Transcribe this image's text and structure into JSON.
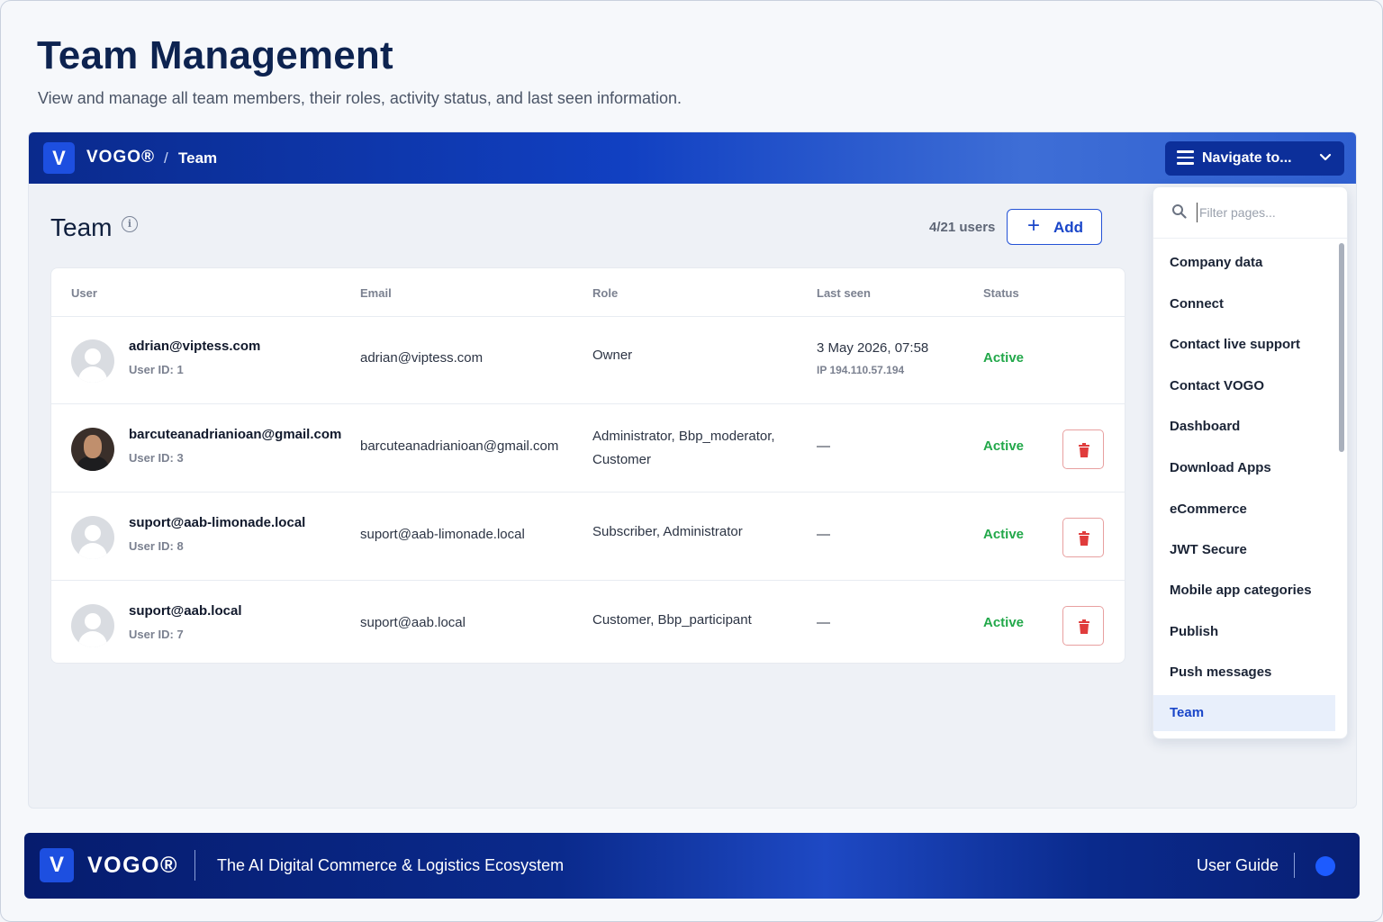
{
  "header": {
    "title": "Team Management",
    "subtitle": "View and manage all team members, their roles, activity status, and last seen information."
  },
  "topbar": {
    "logo_letter": "V",
    "brand": "VOGO®",
    "separator": "/",
    "crumb": "Team",
    "navigate_label": "Navigate to..."
  },
  "team": {
    "title": "Team",
    "users_count": "4/21 users",
    "add_label": "Add",
    "columns": {
      "user": "User",
      "email": "Email",
      "role": "Role",
      "last_seen": "Last seen",
      "status": "Status"
    },
    "rows": [
      {
        "name": "adrian@viptess.com",
        "user_id": "User ID: 1",
        "email": "adrian@viptess.com",
        "role": "Owner",
        "last_seen": "3 May 2026, 07:58",
        "ip": "IP 194.110.57.194",
        "status": "Active",
        "avatar": "placeholder",
        "deletable": false
      },
      {
        "name": "barcuteanadrianioan@gmail.com",
        "user_id": "User ID: 3",
        "email": "barcuteanadrianioan@gmail.com",
        "role_line1": "Administrator, Bbp_moderator,",
        "role_line2": "Customer",
        "last_seen": "—",
        "status": "Active",
        "avatar": "photo",
        "deletable": true
      },
      {
        "name": "suport@aab-limonade.local",
        "user_id": "User ID: 8",
        "email": "suport@aab-limonade.local",
        "role": "Subscriber, Administrator",
        "last_seen": "—",
        "status": "Active",
        "avatar": "placeholder",
        "deletable": true
      },
      {
        "name": "suport@aab.local",
        "user_id": "User ID: 7",
        "email": "suport@aab.local",
        "role": "Customer, Bbp_participant",
        "last_seen": "—",
        "status": "Active",
        "avatar": "placeholder",
        "deletable": true
      }
    ]
  },
  "dropdown": {
    "search_placeholder": "Filter pages...",
    "items": [
      "Company data",
      "Connect",
      "Contact live support",
      "Contact VOGO",
      "Dashboard",
      "Download Apps",
      "eCommerce",
      "JWT Secure",
      "Mobile app categories",
      "Publish",
      "Push messages",
      "Team"
    ],
    "active_item": "Team"
  },
  "footer": {
    "logo_letter": "V",
    "brand": "VOGO®",
    "tagline": "The AI Digital Commerce & Logistics Ecosystem",
    "user_guide": "User Guide"
  },
  "colors": {
    "primary": "#1a46c9",
    "active_status": "#22a84a",
    "danger": "#e03c3c",
    "topbar_dark": "#0a2a8c"
  },
  "icons": {
    "info": "info-icon",
    "menu": "menu-icon",
    "chevron": "chevron-down-icon",
    "search": "search-icon",
    "plus": "plus-icon",
    "trash": "trash-icon"
  }
}
